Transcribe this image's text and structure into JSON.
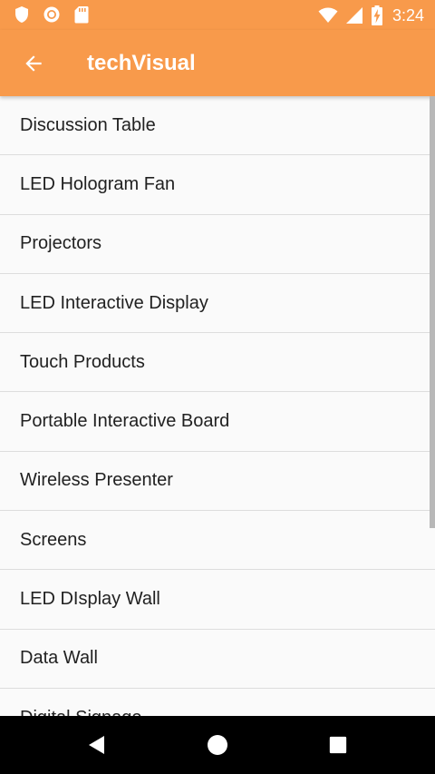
{
  "status_bar": {
    "time": "3:24",
    "left_icons": [
      "shield-icon",
      "record-icon",
      "sd-card-icon"
    ],
    "right_icons": [
      "wifi-icon",
      "signal-icon",
      "battery-charging-icon"
    ]
  },
  "app_bar": {
    "title": "techVisual",
    "back_icon": "arrow-left-icon",
    "background": "#f89a4b"
  },
  "list": {
    "items": [
      {
        "label": "Discussion Table"
      },
      {
        "label": "LED Hologram Fan"
      },
      {
        "label": "Projectors"
      },
      {
        "label": "LED Interactive Display"
      },
      {
        "label": "Touch Products"
      },
      {
        "label": "Portable Interactive Board"
      },
      {
        "label": "Wireless Presenter"
      },
      {
        "label": "Screens"
      },
      {
        "label": "LED DIsplay Wall"
      },
      {
        "label": "Data Wall"
      },
      {
        "label": "Digital Signage"
      }
    ]
  },
  "nav_bar": {
    "icons": [
      "back-triangle-icon",
      "home-circle-icon",
      "recents-square-icon"
    ]
  }
}
